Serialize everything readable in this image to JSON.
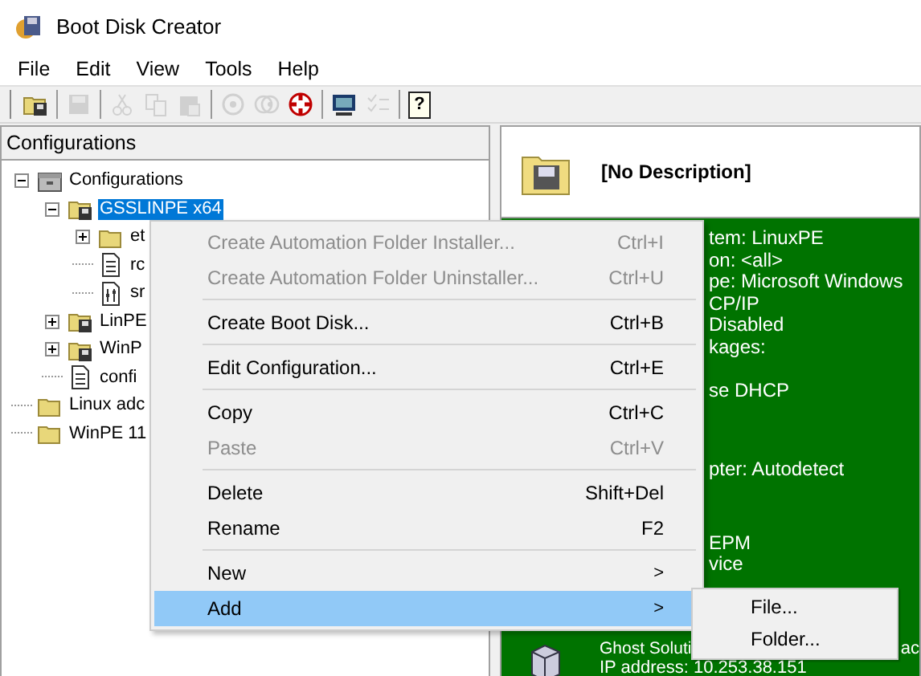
{
  "window": {
    "title": "Boot Disk Creator"
  },
  "menu_bar": [
    "File",
    "Edit",
    "View",
    "Tools",
    "Help"
  ],
  "toolbar": [
    {
      "kind": "open",
      "disabled": false
    },
    {
      "kind": "separator"
    },
    {
      "kind": "save",
      "disabled": true
    },
    {
      "kind": "separator"
    },
    {
      "kind": "cut",
      "disabled": true
    },
    {
      "kind": "copy",
      "disabled": true
    },
    {
      "kind": "paste",
      "disabled": true
    },
    {
      "kind": "separator"
    },
    {
      "kind": "disc",
      "disabled": true
    },
    {
      "kind": "discs",
      "disabled": true
    },
    {
      "kind": "lifebuoy",
      "disabled": false
    },
    {
      "kind": "separator"
    },
    {
      "kind": "monitor",
      "disabled": false
    },
    {
      "kind": "checklist",
      "disabled": true
    },
    {
      "kind": "separator"
    },
    {
      "kind": "help",
      "glyph": "?",
      "disabled": false
    }
  ],
  "tree_header": "Configurations",
  "tree": [
    {
      "label": "Configurations",
      "kind": "root",
      "expanded": true,
      "selected": false,
      "children": [
        {
          "label": "GSSLINPE x64",
          "kind": "config",
          "expanded": true,
          "selected": true,
          "children": [
            {
              "label": "et",
              "kind": "folder",
              "expanded": false,
              "selected": false
            },
            {
              "label": "rc",
              "kind": "file",
              "selected": false
            },
            {
              "label": "sr",
              "kind": "settings",
              "selected": false
            }
          ]
        },
        {
          "label": "LinPE",
          "kind": "config",
          "expanded": false,
          "selected": false
        },
        {
          "label": "WinP",
          "kind": "config",
          "expanded": false,
          "selected": false
        },
        {
          "label": "confi",
          "kind": "file",
          "selected": false
        }
      ]
    },
    {
      "label": "Linux adc",
      "kind": "folder",
      "selected": false
    },
    {
      "label": "WinPE 11",
      "kind": "folder",
      "selected": false
    }
  ],
  "details": {
    "description": "[No Description]",
    "groups": [
      [
        "tem: LinuxPE",
        "on: <all>",
        "pe: Microsoft Windows",
        "CP/IP",
        "Disabled",
        "kages:"
      ],
      [
        "se DHCP"
      ],
      [
        "pter: Autodetect"
      ],
      [
        "EPM",
        "vice"
      ]
    ],
    "ghost": {
      "title_start": "Ghost Soluti",
      "title_end": "ac",
      "address": "IP address: 10.253.38.151"
    }
  },
  "context_menu": [
    [
      {
        "label": "Create Automation Folder Installer...",
        "shortcut": "Ctrl+I",
        "disabled": true,
        "selected": false
      },
      {
        "label": "Create Automation Folder Uninstaller...",
        "shortcut": "Ctrl+U",
        "disabled": true,
        "selected": false
      }
    ],
    [
      {
        "label": "Create Boot Disk...",
        "shortcut": "Ctrl+B",
        "disabled": false,
        "selected": false
      }
    ],
    [
      {
        "label": "Edit Configuration...",
        "shortcut": "Ctrl+E",
        "disabled": false,
        "selected": false
      }
    ],
    [
      {
        "label": "Copy",
        "shortcut": "Ctrl+C",
        "disabled": false,
        "selected": false
      },
      {
        "label": "Paste",
        "shortcut": "Ctrl+V",
        "disabled": true,
        "selected": false
      }
    ],
    [
      {
        "label": "Delete",
        "shortcut": "Shift+Del",
        "disabled": false,
        "selected": false
      },
      {
        "label": "Rename",
        "shortcut": "F2",
        "disabled": false,
        "selected": false
      }
    ],
    [
      {
        "label": "New",
        "arrow": ">",
        "disabled": false,
        "selected": false
      },
      {
        "label": "Add",
        "arrow": ">",
        "disabled": false,
        "selected": true
      }
    ]
  ],
  "submenu": [
    {
      "label": "File...",
      "selected": false
    },
    {
      "label": "Folder...",
      "selected": false
    }
  ]
}
